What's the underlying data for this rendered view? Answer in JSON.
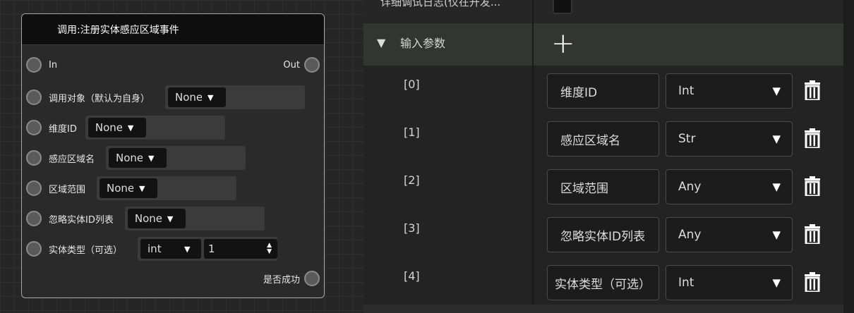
{
  "node": {
    "title": "调用:注册实体感应区域事件",
    "in_label": "In",
    "out_label": "Out",
    "inputs": [
      {
        "label": "调用对象（默认为自身）",
        "value": "None"
      },
      {
        "label": "维度ID",
        "value": "None"
      },
      {
        "label": "感应区域名",
        "value": "None"
      },
      {
        "label": "区域范围",
        "value": "None"
      },
      {
        "label": "忽略实体ID列表",
        "value": "None"
      },
      {
        "label": "实体类型（可选）",
        "value": "int",
        "number": "1"
      }
    ],
    "output_label": "是否成功"
  },
  "panel": {
    "top_label": "详细调试日志(仅在开发...",
    "section_title": "输入参数",
    "add_icon": "plus-icon",
    "params": [
      {
        "index": "[0]",
        "name": "维度ID",
        "type": "Int"
      },
      {
        "index": "[1]",
        "name": "感应区域名",
        "type": "Str"
      },
      {
        "index": "[2]",
        "name": "区域范围",
        "type": "Any"
      },
      {
        "index": "[3]",
        "name": "忽略实体ID列表",
        "type": "Any"
      },
      {
        "index": "[4]",
        "name": "实体类型（可选）",
        "type": "Int"
      }
    ]
  }
}
